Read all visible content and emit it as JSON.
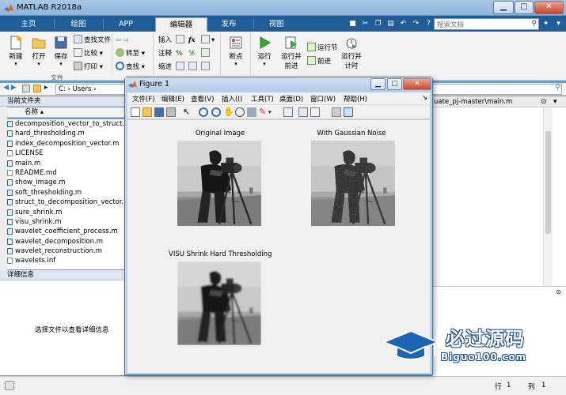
{
  "app": {
    "title": "MATLAB R2018a"
  },
  "tabs": [
    "主页",
    "绘图",
    "APP",
    "编辑器",
    "发布",
    "视图"
  ],
  "search": {
    "placeholder": "搜索文档"
  },
  "ribbon": {
    "new": "新建",
    "open": "打开",
    "save": "保存",
    "find_file": "查找文件",
    "compare": "比较",
    "print": "打印",
    "goto": "转至",
    "find": "查找",
    "insert": "插入",
    "comment": "注释",
    "indent": "缩进",
    "breakpoints": "断点",
    "run": "运行",
    "run_advance": [
      "运行并",
      "前进"
    ],
    "run_section": "运行节",
    "advance": "前进",
    "run_time": [
      "运行并",
      "计时"
    ],
    "group_file": "文件",
    "fx": "fx"
  },
  "address": {
    "path": "C:  ›  Users  ›"
  },
  "current_folder": {
    "header": "当前文件夹",
    "col_name": "名称",
    "files": [
      {
        "name": "decomposition_vector_to_struct.m",
        "type": "m"
      },
      {
        "name": "hard_thresholding.m",
        "type": "m"
      },
      {
        "name": "index_decomposition_vector.m",
        "type": "m"
      },
      {
        "name": "LICENSE",
        "type": "txt"
      },
      {
        "name": "main.m",
        "type": "m"
      },
      {
        "name": "README.md",
        "type": "txt"
      },
      {
        "name": "show_image.m",
        "type": "m"
      },
      {
        "name": "soft_thresholding.m",
        "type": "m"
      },
      {
        "name": "struct_to_decomposition_vector.m",
        "type": "m"
      },
      {
        "name": "sure_shrink.m",
        "type": "m"
      },
      {
        "name": "visu_shrink.m",
        "type": "m"
      },
      {
        "name": "wavelet_coefficient_process.m",
        "type": "m"
      },
      {
        "name": "wavelet_decomposition.m",
        "type": "m"
      },
      {
        "name": "wavelet_reconstruction.m",
        "type": "m"
      },
      {
        "name": "wavelets.inf",
        "type": "txt"
      }
    ]
  },
  "details": {
    "header": "详细信息",
    "hint": "选择文件以查看详细信息"
  },
  "editor": {
    "tab": "uate_pj-master\\main.m"
  },
  "status": {
    "col_label": "行",
    "line": "1",
    "row_label": "列",
    "col": "1"
  },
  "figure": {
    "title": "Figure 1",
    "menu": [
      "文件(F)",
      "编辑(E)",
      "查看(V)",
      "插入(I)",
      "工具(T)",
      "桌面(D)",
      "窗口(W)",
      "帮助(H)"
    ],
    "plots": [
      {
        "title": "Original Image",
        "variant": "clean"
      },
      {
        "title": "With Gaussian Noise",
        "variant": "noisy"
      },
      {
        "title": "VISU Shrink Hard Thresholding",
        "variant": "smooth"
      }
    ]
  },
  "watermark": {
    "brand": "必过源码",
    "url": "Biguo100.com"
  }
}
